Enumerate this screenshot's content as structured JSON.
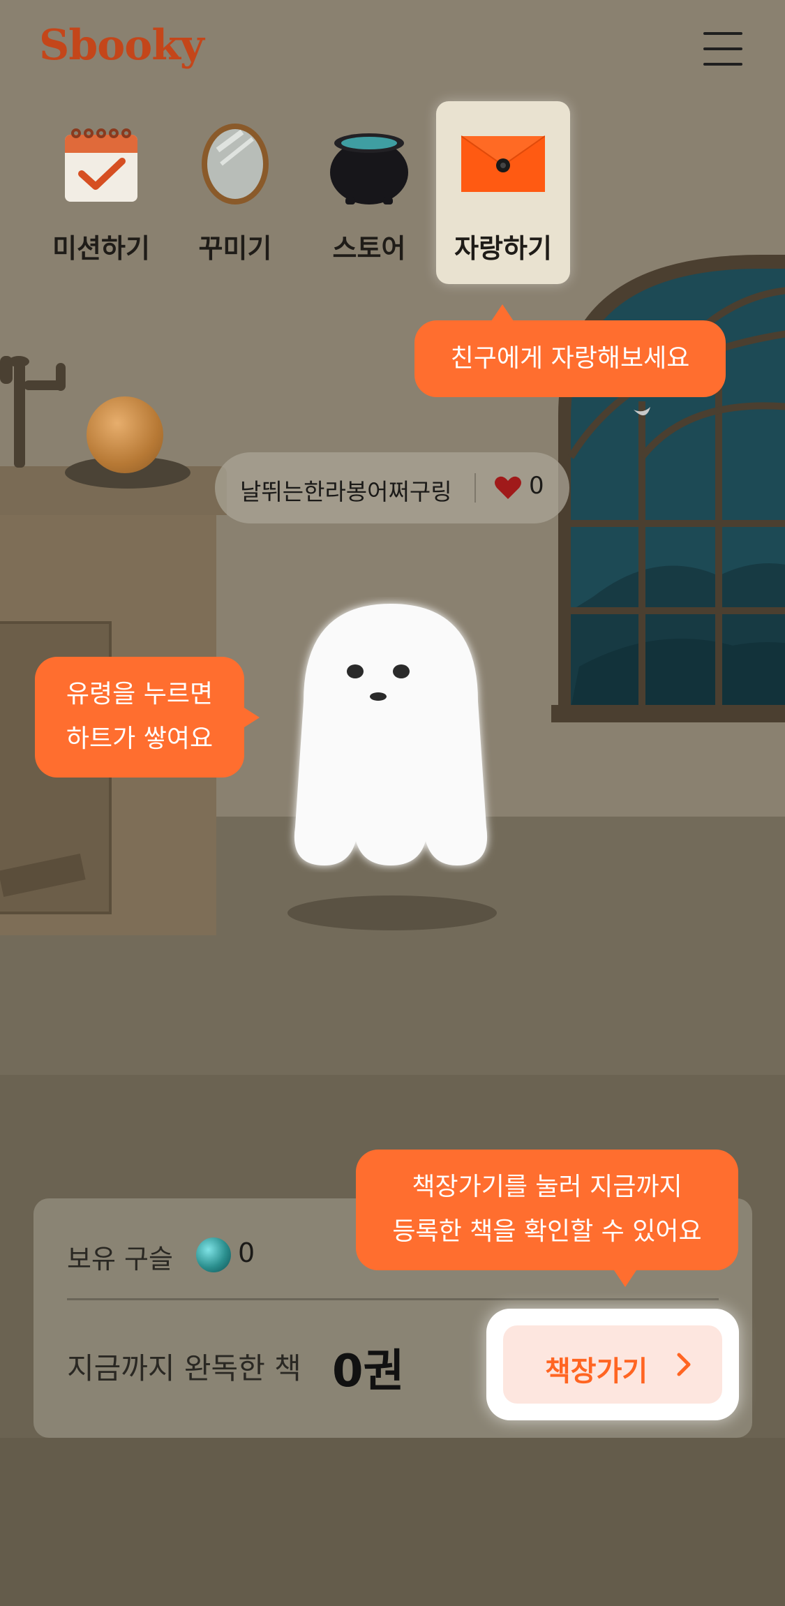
{
  "app": {
    "logo_text": "Sbooky"
  },
  "colors": {
    "accent": "#ff6e2f",
    "logo": "#c4461a",
    "button_bg": "#fde6df",
    "heart": "#a01a1a"
  },
  "header": {
    "menu_icon": "hamburger-menu-icon"
  },
  "nav": {
    "items": [
      {
        "label": "미션하기",
        "icon": "calendar-check-icon",
        "active": false
      },
      {
        "label": "꾸미기",
        "icon": "mirror-icon",
        "active": false
      },
      {
        "label": "스토어",
        "icon": "cauldron-icon",
        "active": false
      },
      {
        "label": "자랑하기",
        "icon": "envelope-icon",
        "active": true
      }
    ]
  },
  "tooltips": {
    "share": "친구에게 자랑해보세요",
    "ghost_line1": "유령을 누르면",
    "ghost_line2": "하트가 쌓여요",
    "bookshelf_line1": "책장가기를 눌러 지금까지",
    "bookshelf_line2": "등록한 책을 확인할 수 있어요"
  },
  "profile": {
    "nickname": "날뛰는한라봉어쩌구링",
    "likes": "0",
    "heart_icon": "heart-icon"
  },
  "character": {
    "icon": "ghost-character"
  },
  "stats": {
    "beads_label": "보유 구슬",
    "beads_icon": "marble-icon",
    "beads_count": "0",
    "read_label": "지금까지 완독한 책",
    "read_count": "0권"
  },
  "bookshelf_button": {
    "label": "책장가기",
    "icon": "chevron-right-icon"
  }
}
